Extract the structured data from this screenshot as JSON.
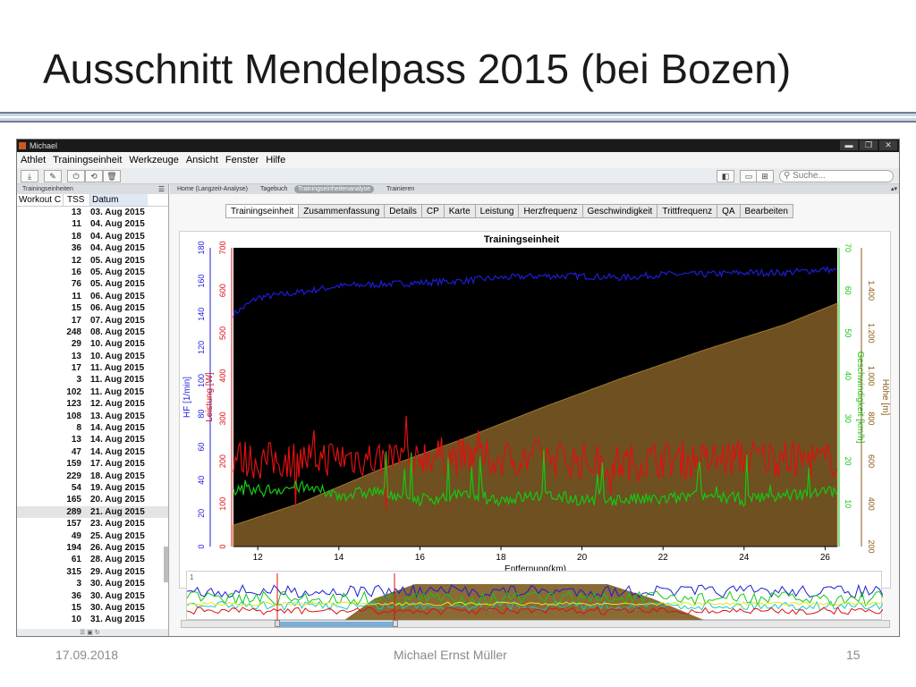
{
  "slide": {
    "title": "Ausschnitt Mendelpass 2015 (bei Bozen)",
    "footer_date": "17.09.2018",
    "footer_author": "Michael Ernst Müller",
    "footer_page": "15"
  },
  "window": {
    "title": "Michael",
    "controls": [
      "▬",
      "❐",
      "✕"
    ],
    "menu": [
      "Athlet",
      "Trainingseinheit",
      "Werkzeuge",
      "Ansicht",
      "Fenster",
      "Hilfe"
    ],
    "search_placeholder": "Suche..."
  },
  "sidebar": {
    "header": "Trainingseinheiten",
    "col_workout": "Workout C",
    "col_tss": "TSS",
    "col_date": "Datum",
    "rows": [
      {
        "tss": "13",
        "date": "03. Aug 2015"
      },
      {
        "tss": "11",
        "date": "04. Aug 2015"
      },
      {
        "tss": "18",
        "date": "04. Aug 2015"
      },
      {
        "tss": "36",
        "date": "04. Aug 2015"
      },
      {
        "tss": "12",
        "date": "05. Aug 2015"
      },
      {
        "tss": "16",
        "date": "05. Aug 2015"
      },
      {
        "tss": "76",
        "date": "05. Aug 2015"
      },
      {
        "tss": "11",
        "date": "06. Aug 2015"
      },
      {
        "tss": "15",
        "date": "06. Aug 2015"
      },
      {
        "tss": "17",
        "date": "07. Aug 2015"
      },
      {
        "tss": "248",
        "date": "08. Aug 2015"
      },
      {
        "tss": "29",
        "date": "10. Aug 2015"
      },
      {
        "tss": "13",
        "date": "10. Aug 2015"
      },
      {
        "tss": "17",
        "date": "11. Aug 2015"
      },
      {
        "tss": "3",
        "date": "11. Aug 2015"
      },
      {
        "tss": "102",
        "date": "11. Aug 2015"
      },
      {
        "tss": "123",
        "date": "12. Aug 2015"
      },
      {
        "tss": "108",
        "date": "13. Aug 2015"
      },
      {
        "tss": "8",
        "date": "14. Aug 2015"
      },
      {
        "tss": "13",
        "date": "14. Aug 2015"
      },
      {
        "tss": "47",
        "date": "14. Aug 2015"
      },
      {
        "tss": "159",
        "date": "17. Aug 2015"
      },
      {
        "tss": "229",
        "date": "18. Aug 2015"
      },
      {
        "tss": "54",
        "date": "19. Aug 2015"
      },
      {
        "tss": "165",
        "date": "20. Aug 2015"
      },
      {
        "tss": "289",
        "date": "21. Aug 2015",
        "selected": true
      },
      {
        "tss": "157",
        "date": "23. Aug 2015"
      },
      {
        "tss": "49",
        "date": "25. Aug 2015"
      },
      {
        "tss": "194",
        "date": "26. Aug 2015"
      },
      {
        "tss": "61",
        "date": "28. Aug 2015"
      },
      {
        "tss": "315",
        "date": "29. Aug 2015"
      },
      {
        "tss": "3",
        "date": "30. Aug 2015"
      },
      {
        "tss": "36",
        "date": "30. Aug 2015"
      },
      {
        "tss": "15",
        "date": "30. Aug 2015"
      },
      {
        "tss": "10",
        "date": "31. Aug 2015"
      }
    ]
  },
  "views": {
    "items": [
      "Home (Langzeit-Analyse)",
      "Tagebuch",
      "Trainingseinheitenanalyse",
      "Trainieren"
    ],
    "active_index": 2
  },
  "tabs": [
    "Trainingseinheit",
    "Zusammenfassung",
    "Details",
    "CP",
    "Karte",
    "Leistung",
    "Herzfrequenz",
    "Geschwindigkeit",
    "Trittfrequenz",
    "QA",
    "Bearbeiten"
  ],
  "chart_data": {
    "type": "line",
    "title": "Trainingseinheit",
    "xlabel": "Entfernung(km)",
    "xlim": [
      11.4,
      26.3
    ],
    "x_ticks": [
      12,
      14,
      16,
      18,
      20,
      22,
      24,
      26
    ],
    "axes": {
      "hr": {
        "label": "HF [1/min]",
        "color": "#1d1dd8",
        "range": [
          0,
          180
        ],
        "ticks": [
          0,
          20,
          40,
          60,
          80,
          100,
          120,
          140,
          160,
          180
        ]
      },
      "power": {
        "label": "Leistung [W]",
        "color": "#e01010",
        "range": [
          0,
          700
        ],
        "ticks": [
          0,
          100,
          200,
          300,
          400,
          500,
          600,
          700
        ]
      },
      "speed": {
        "label": "Geschwindigkeit [km/h]",
        "color": "#14c814",
        "range": [
          0,
          70
        ],
        "ticks": [
          10,
          20,
          30,
          40,
          50,
          60,
          70
        ]
      },
      "altitude": {
        "label": "Höhe [m]",
        "color": "#8b5a14",
        "range": [
          200,
          1600
        ],
        "ticks": [
          "200",
          "400",
          "600",
          "800",
          "1.000",
          "1.200",
          "1.400"
        ]
      }
    },
    "series": [
      {
        "name": "Höhe [m]",
        "axis": "altitude",
        "color": "#6e5021",
        "x": [
          11.4,
          13,
          15,
          17,
          19,
          21,
          23,
          25,
          26.3
        ],
        "values": [
          300,
          400,
          560,
          700,
          850,
          990,
          1120,
          1240,
          1340
        ]
      },
      {
        "name": "HF [1/min]",
        "axis": "hr",
        "color": "#1d1dd8",
        "x": [
          11.4,
          12,
          13,
          14,
          15,
          16,
          17,
          18,
          19,
          20,
          21,
          22,
          23,
          24,
          25,
          26,
          26.3
        ],
        "values": [
          140,
          150,
          153,
          157,
          158,
          159,
          160,
          162,
          163,
          163,
          162,
          164,
          164,
          165,
          165,
          167,
          166
        ]
      },
      {
        "name": "Leistung [W]",
        "axis": "power",
        "color": "#e01010",
        "x": [
          11.4,
          12,
          13,
          14,
          15,
          16,
          17,
          18,
          19,
          20,
          21,
          22,
          23,
          24,
          25,
          26,
          26.3
        ],
        "values": [
          210,
          200,
          205,
          210,
          205,
          215,
          210,
          205,
          210,
          200,
          195,
          205,
          200,
          210,
          205,
          200,
          210
        ]
      },
      {
        "name": "Geschwindigkeit [km/h]",
        "axis": "speed",
        "color": "#14c814",
        "x": [
          11.4,
          12,
          13,
          14,
          15,
          16,
          17,
          18,
          19,
          20,
          21,
          22,
          23,
          24,
          25,
          26,
          26.3
        ],
        "values": [
          13,
          13,
          14,
          12,
          13,
          11,
          12,
          11,
          12,
          11,
          11,
          11,
          12,
          11,
          12,
          13,
          13
        ]
      }
    ]
  },
  "overview": {
    "marker_label": "1"
  },
  "sidebar_footer": "☰  ▣  ↻"
}
